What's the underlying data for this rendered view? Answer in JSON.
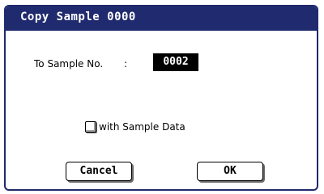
{
  "dialog": {
    "title": "Copy Sample 0000",
    "field": {
      "label": "To Sample No.",
      "separator": ":",
      "value": "0002"
    },
    "checkbox": {
      "label": "with Sample Data",
      "checked": false
    },
    "buttons": {
      "cancel": "Cancel",
      "ok": "OK"
    }
  },
  "colors": {
    "titlebar": "#202a6e",
    "title_text": "#ffffff",
    "value_background": "#000000"
  }
}
